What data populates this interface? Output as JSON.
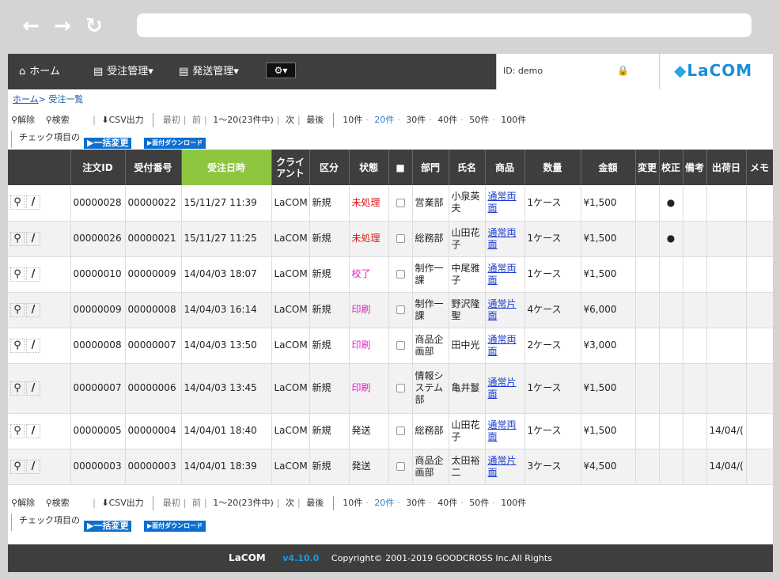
{
  "browser": {
    "back_icon": "←",
    "forward_icon": "→",
    "reload_icon": "↻"
  },
  "nav": {
    "home": "ホーム",
    "orders": "受注管理▾",
    "shipping": "発送管理▾",
    "settings": "⚙▾",
    "user_id": "ID: demo",
    "logo": "LaCOM"
  },
  "breadcrumb": {
    "home": "ホーム",
    "sep": ">",
    "current": "受注一覧"
  },
  "toolbar": {
    "clear": "解除",
    "search": "検索",
    "csv": "CSV出力",
    "first": "最初",
    "prev": "前",
    "range": "1〜20(23件中)",
    "next": "次",
    "last": "最後",
    "per_page": [
      "10件",
      "20件",
      "30件",
      "40件",
      "50件",
      "100件"
    ],
    "checked_label": "チェック項目の",
    "bulk_change": "▶一括変更",
    "label_download": "▶面付ダウンロード"
  },
  "columns": [
    "",
    "注文ID",
    "受付番号",
    "受注日時",
    "クライアント",
    "区分",
    "状態",
    "■",
    "部門",
    "氏名",
    "商品",
    "数量",
    "金額",
    "変更",
    "校正",
    "備考",
    "出荷日",
    "メモ"
  ],
  "rows": [
    {
      "order_id": "00000028",
      "receipt": "00000022",
      "date": "15/11/27 11:39",
      "client": "LaCOM",
      "type": "新規",
      "status": "未処理",
      "status_color": "red",
      "dept": "営業部",
      "name": "小泉英夫",
      "product": "通常両面",
      "qty": "1ケース",
      "amount": "¥1,500",
      "change": "",
      "proof": "●",
      "note": "",
      "ship": "",
      "memo": ""
    },
    {
      "order_id": "00000026",
      "receipt": "00000021",
      "date": "15/11/27 11:25",
      "client": "LaCOM",
      "type": "新規",
      "status": "未処理",
      "status_color": "red",
      "dept": "総務部",
      "name": "山田花子",
      "product": "通常両面",
      "qty": "1ケース",
      "amount": "¥1,500",
      "change": "",
      "proof": "●",
      "note": "",
      "ship": "",
      "memo": ""
    },
    {
      "order_id": "00000010",
      "receipt": "00000009",
      "date": "14/04/03 18:07",
      "client": "LaCOM",
      "type": "新規",
      "status": "校了",
      "status_color": "pink",
      "dept": "制作一課",
      "name": "中尾雅子",
      "product": "通常両面",
      "qty": "1ケース",
      "amount": "¥1,500",
      "change": "",
      "proof": "",
      "note": "",
      "ship": "",
      "memo": ""
    },
    {
      "order_id": "00000009",
      "receipt": "00000008",
      "date": "14/04/03 16:14",
      "client": "LaCOM",
      "type": "新規",
      "status": "印刷",
      "status_color": "pink",
      "dept": "制作一課",
      "name": "野沢隆聖",
      "product": "通常片面",
      "qty": "4ケース",
      "amount": "¥6,000",
      "change": "",
      "proof": "",
      "note": "",
      "ship": "",
      "memo": ""
    },
    {
      "order_id": "00000008",
      "receipt": "00000007",
      "date": "14/04/03 13:50",
      "client": "LaCOM",
      "type": "新規",
      "status": "印刷",
      "status_color": "pink",
      "dept": "商品企画部",
      "name": "田中光",
      "product": "通常両面",
      "qty": "2ケース",
      "amount": "¥3,000",
      "change": "",
      "proof": "",
      "note": "",
      "ship": "",
      "memo": ""
    },
    {
      "order_id": "00000007",
      "receipt": "00000006",
      "date": "14/04/03 13:45",
      "client": "LaCOM",
      "type": "新規",
      "status": "印刷",
      "status_color": "pink",
      "dept": "情報システム部",
      "name": "亀井鬘",
      "product": "通常片面",
      "qty": "1ケース",
      "amount": "¥1,500",
      "change": "",
      "proof": "",
      "note": "",
      "ship": "",
      "memo": ""
    },
    {
      "order_id": "00000005",
      "receipt": "00000004",
      "date": "14/04/01 18:40",
      "client": "LaCOM",
      "type": "新規",
      "status": "発送",
      "status_color": "black",
      "dept": "総務部",
      "name": "山田花子",
      "product": "通常両面",
      "qty": "1ケース",
      "amount": "¥1,500",
      "change": "",
      "proof": "",
      "note": "",
      "ship": "14/04/(",
      "memo": ""
    },
    {
      "order_id": "00000003",
      "receipt": "00000003",
      "date": "14/04/01 18:39",
      "client": "LaCOM",
      "type": "新規",
      "status": "発送",
      "status_color": "black",
      "dept": "商品企画部",
      "name": "太田裕二",
      "product": "通常片面",
      "qty": "3ケース",
      "amount": "¥4,500",
      "change": "",
      "proof": "",
      "note": "",
      "ship": "14/04/(",
      "memo": ""
    }
  ],
  "footer": {
    "logo": "LaCOM",
    "version": "v4.10.0",
    "copyright": "Copyright© 2001-2019 GOODCROSS Inc.All Rights"
  }
}
